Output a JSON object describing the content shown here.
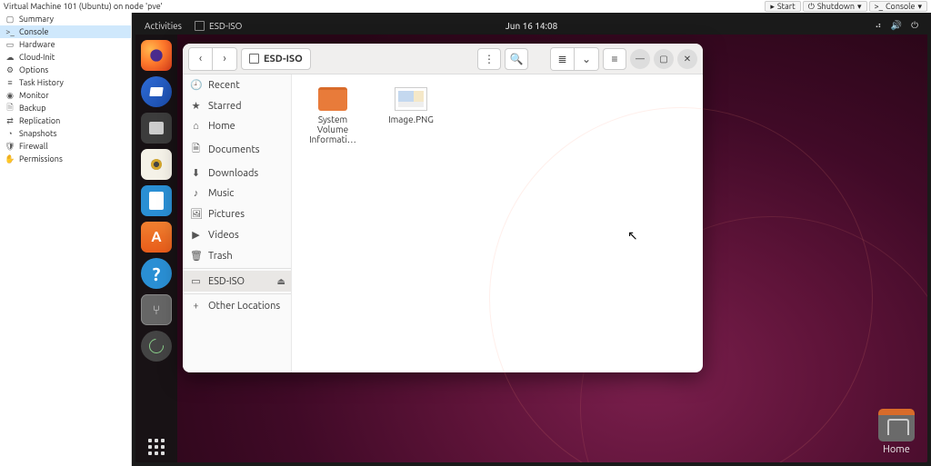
{
  "pve": {
    "title": "Virtual Machine 101 (Ubuntu) on node 'pve'",
    "buttons": {
      "start": "Start",
      "shutdown": "Shutdown",
      "console": "Console"
    },
    "sidebar": [
      {
        "icon": "▢",
        "label": "Summary"
      },
      {
        "icon": ">_",
        "label": "Console",
        "selected": true
      },
      {
        "icon": "▭",
        "label": "Hardware"
      },
      {
        "icon": "☁",
        "label": "Cloud-Init"
      },
      {
        "icon": "⚙",
        "label": "Options"
      },
      {
        "icon": "≡",
        "label": "Task History"
      },
      {
        "icon": "◉",
        "label": "Monitor"
      },
      {
        "icon": "🗎",
        "label": "Backup"
      },
      {
        "icon": "⇄",
        "label": "Replication"
      },
      {
        "icon": "◔",
        "label": "Snapshots"
      },
      {
        "icon": "🛡",
        "label": "Firewall"
      },
      {
        "icon": "✋",
        "label": "Permissions"
      }
    ]
  },
  "ubuntu": {
    "topbar": {
      "activities": "Activities",
      "app": "ESD-ISO",
      "clock": "Jun 16  14:08"
    },
    "desktop": {
      "home_label": "Home"
    },
    "nautilus": {
      "path": "ESD-ISO",
      "sidebar": [
        {
          "icon": "🕘",
          "label": "Recent"
        },
        {
          "icon": "★",
          "label": "Starred"
        },
        {
          "icon": "⌂",
          "label": "Home"
        },
        {
          "icon": "🗎",
          "label": "Documents"
        },
        {
          "icon": "⬇",
          "label": "Downloads"
        },
        {
          "icon": "♪",
          "label": "Music"
        },
        {
          "icon": "🖼",
          "label": "Pictures"
        },
        {
          "icon": "▶",
          "label": "Videos"
        },
        {
          "icon": "🗑",
          "label": "Trash"
        }
      ],
      "devices": [
        {
          "icon": "▭",
          "label": "ESD-ISO",
          "selected": true,
          "eject": true
        }
      ],
      "other": [
        {
          "icon": "+",
          "label": "Other Locations"
        }
      ],
      "files": [
        {
          "type": "folder",
          "name": "System Volume Informati…"
        },
        {
          "type": "image",
          "name": "Image.PNG"
        }
      ]
    }
  }
}
